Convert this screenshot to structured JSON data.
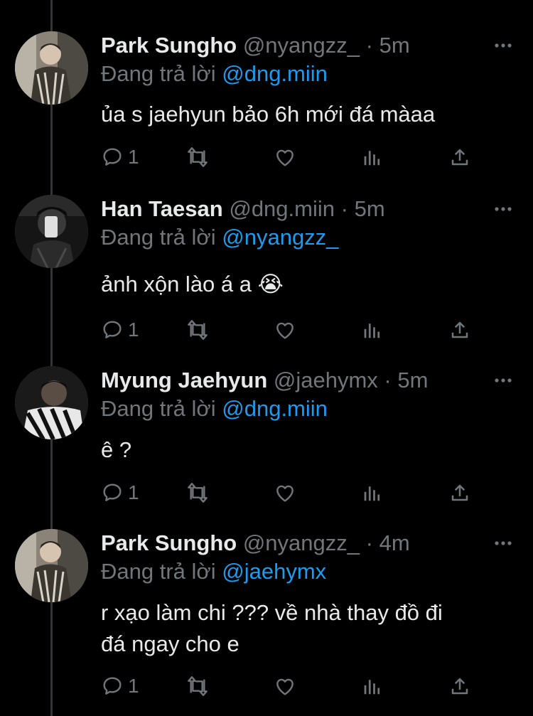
{
  "tweets": [
    {
      "author": "Park Sungho",
      "handle": "@nyangzz_",
      "time": "5m",
      "reply_prefix": "Đang trả lời",
      "reply_to": "@dng.miin",
      "text_lines": [
        "ủa s jaehyun bảo 6h mới đá màaa"
      ],
      "reply_count": "1"
    },
    {
      "author": "Han Taesan",
      "handle": "@dng.miin",
      "time": "5m",
      "reply_prefix": "Đang trả lời",
      "reply_to": "@nyangzz_",
      "text_lines": [
        "ảnh xộn lào á a 😭"
      ],
      "reply_count": "1"
    },
    {
      "author": "Myung Jaehyun",
      "handle": "@jaehymx",
      "time": "5m",
      "reply_prefix": "Đang trả lời",
      "reply_to": "@dng.miin",
      "text_lines": [
        "ê ?"
      ],
      "reply_count": "1"
    },
    {
      "author": "Park Sungho",
      "handle": "@nyangzz_",
      "time": "4m",
      "reply_prefix": "Đang trả lời",
      "reply_to": "@jaehymx",
      "text_lines": [
        "r xạo làm chi ??? về nhà thay đồ đi",
        "đá ngay cho e"
      ],
      "reply_count": "1"
    }
  ],
  "separator": "·",
  "icons": [
    "reply-icon",
    "retweet-icon",
    "like-icon",
    "analytics-icon",
    "share-icon",
    "more-icon"
  ],
  "colors": {
    "background": "#000000",
    "text": "#e7e9ea",
    "muted": "#71767b",
    "accent": "#1d9bf0"
  }
}
